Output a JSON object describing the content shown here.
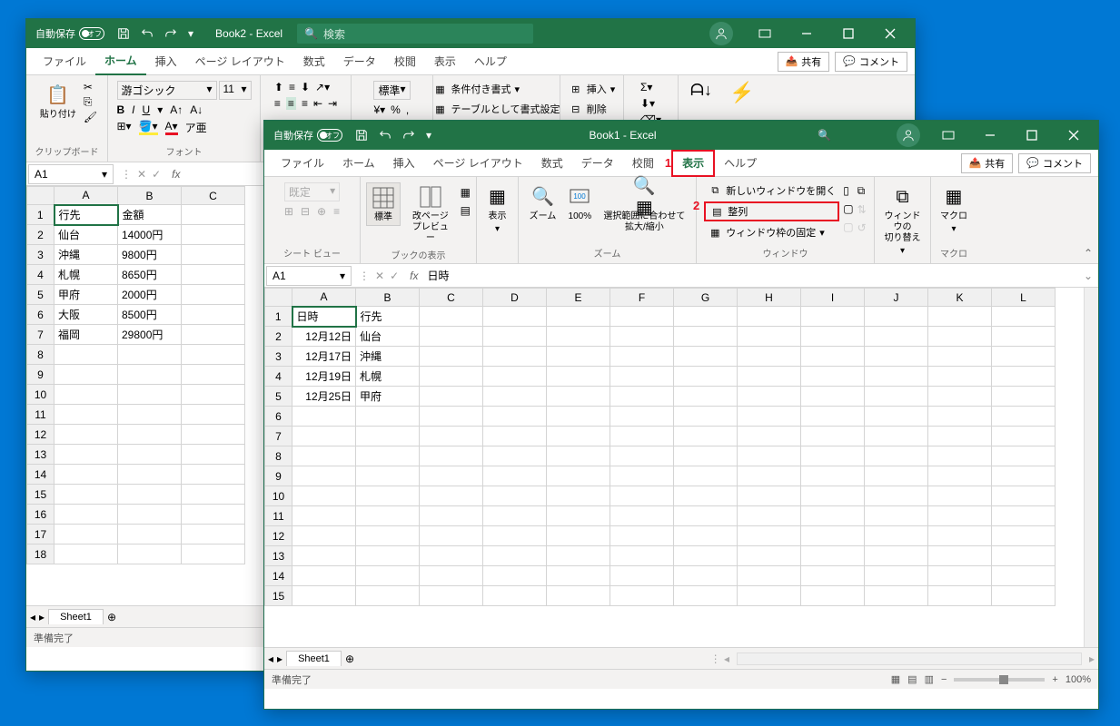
{
  "window2": {
    "autosave_label": "自動保存",
    "autosave_state": "オフ",
    "title": "Book2  -  Excel",
    "search_placeholder": "検索",
    "tabs": [
      "ファイル",
      "ホーム",
      "挿入",
      "ページ レイアウト",
      "数式",
      "データ",
      "校閲",
      "表示",
      "ヘルプ"
    ],
    "active_tab": 1,
    "share": "共有",
    "comment": "コメント",
    "ribbon": {
      "clipboard_label": "クリップボード",
      "paste": "貼り付け",
      "font_label": "フォント",
      "font_name": "游ゴシック",
      "font_size": "11",
      "number_format": "標準",
      "cond_format": "条件付き書式",
      "table_format": "テーブルとして書式設定",
      "insert": "挿入",
      "delete": "削除"
    },
    "namebox": "A1",
    "formula": "",
    "columns": [
      "A",
      "B",
      "C"
    ],
    "rows": [
      {
        "r": "1",
        "a": "行先",
        "b": "金額",
        "c": ""
      },
      {
        "r": "2",
        "a": "仙台",
        "b": "14000円",
        "c": ""
      },
      {
        "r": "3",
        "a": "沖縄",
        "b": "9800円",
        "c": ""
      },
      {
        "r": "4",
        "a": "札幌",
        "b": "8650円",
        "c": ""
      },
      {
        "r": "5",
        "a": "甲府",
        "b": "2000円",
        "c": ""
      },
      {
        "r": "6",
        "a": "大阪",
        "b": "8500円",
        "c": ""
      },
      {
        "r": "7",
        "a": "福岡",
        "b": "29800円",
        "c": ""
      },
      {
        "r": "8",
        "a": "",
        "b": "",
        "c": ""
      },
      {
        "r": "9",
        "a": "",
        "b": "",
        "c": ""
      },
      {
        "r": "10",
        "a": "",
        "b": "",
        "c": ""
      },
      {
        "r": "11",
        "a": "",
        "b": "",
        "c": ""
      },
      {
        "r": "12",
        "a": "",
        "b": "",
        "c": ""
      },
      {
        "r": "13",
        "a": "",
        "b": "",
        "c": ""
      },
      {
        "r": "14",
        "a": "",
        "b": "",
        "c": ""
      },
      {
        "r": "15",
        "a": "",
        "b": "",
        "c": ""
      },
      {
        "r": "16",
        "a": "",
        "b": "",
        "c": ""
      },
      {
        "r": "17",
        "a": "",
        "b": "",
        "c": ""
      },
      {
        "r": "18",
        "a": "",
        "b": "",
        "c": ""
      }
    ],
    "sheet": "Sheet1",
    "status": "準備完了"
  },
  "window1": {
    "autosave_label": "自動保存",
    "autosave_state": "オフ",
    "title": "Book1  -  Excel",
    "tabs": [
      "ファイル",
      "ホーム",
      "挿入",
      "ページ レイアウト",
      "数式",
      "データ",
      "校閲",
      "表示",
      "ヘルプ"
    ],
    "active_tab": 7,
    "share": "共有",
    "comment": "コメント",
    "markers": {
      "one": "1",
      "two": "2"
    },
    "ribbon": {
      "sheetview_label": "シート ビュー",
      "sheetview_default": "既定",
      "bookview_label": "ブックの表示",
      "normal": "標準",
      "pagebreak": "改ページ\nプレビュー",
      "show": "表示",
      "zoom_label": "ズーム",
      "zoom": "ズーム",
      "hundred": "100%",
      "fit_selection": "選択範囲に合わせて\n拡大/縮小",
      "window_label": "ウィンドウ",
      "new_window": "新しいウィンドウを開く",
      "arrange": "整列",
      "freeze": "ウィンドウ枠の固定",
      "switch": "ウィンドウの\n切り替え",
      "macro_label": "マクロ",
      "macro": "マクロ"
    },
    "namebox": "A1",
    "formula": "日時",
    "columns": [
      "A",
      "B",
      "C",
      "D",
      "E",
      "F",
      "G",
      "H",
      "I",
      "J",
      "K",
      "L"
    ],
    "rows": [
      {
        "A": "日時",
        "B": "行先"
      },
      {
        "A": "12月12日",
        "B": "仙台"
      },
      {
        "A": "12月17日",
        "B": "沖縄"
      },
      {
        "A": "12月19日",
        "B": "札幌"
      },
      {
        "A": "12月25日",
        "B": "甲府"
      },
      {},
      {},
      {},
      {},
      {},
      {},
      {},
      {},
      {},
      {}
    ],
    "sheet": "Sheet1",
    "status": "準備完了",
    "zoom": "100%"
  }
}
